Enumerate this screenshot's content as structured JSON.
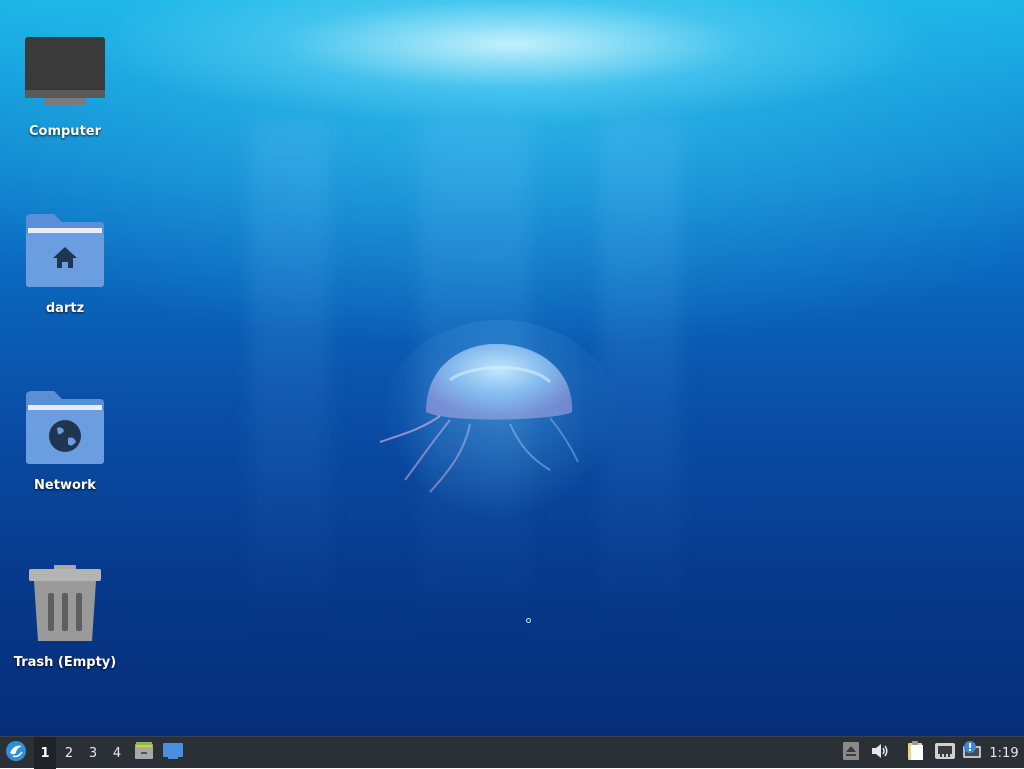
{
  "desktop": {
    "icons": [
      {
        "label": "Computer",
        "icon": "computer-icon"
      },
      {
        "label": "dartz",
        "icon": "home-folder-icon"
      },
      {
        "label": "Network",
        "icon": "network-folder-icon"
      },
      {
        "label": "Trash (Empty)",
        "icon": "trash-icon"
      }
    ]
  },
  "taskbar": {
    "start_icon": "lubuntu-logo-icon",
    "workspaces": [
      "1",
      "2",
      "3",
      "4"
    ],
    "active_workspace": "1",
    "launchers": [
      "file-manager-icon",
      "show-desktop-icon"
    ],
    "tray": [
      "eject-icon",
      "volume-icon",
      "clipboard-icon",
      "network-icon",
      "update-notifier-icon"
    ],
    "clock": "1:19"
  },
  "colors": {
    "taskbar_bg": "#2b3036",
    "folder_blue": "#5a8fd8",
    "accent": "#2f8fd8"
  }
}
